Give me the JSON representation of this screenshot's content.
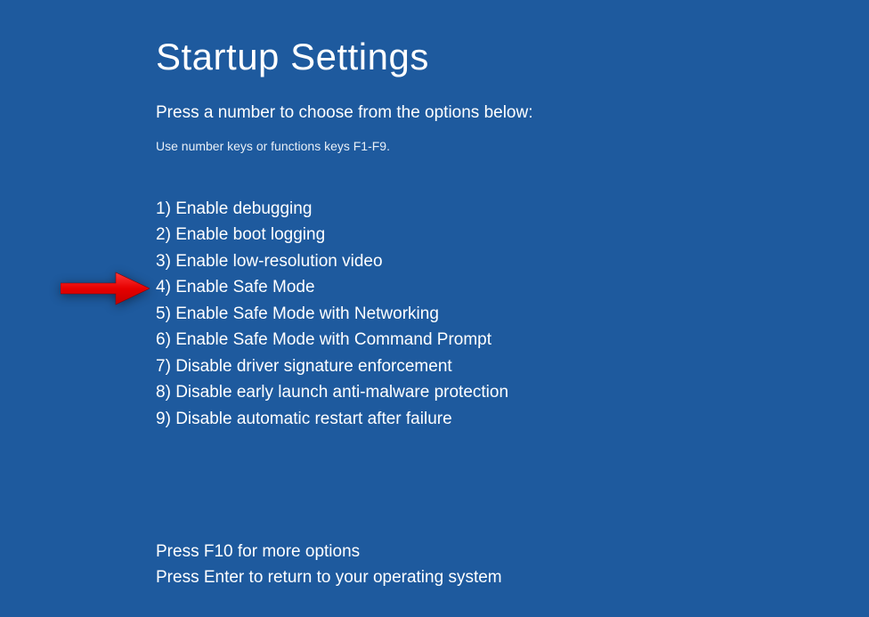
{
  "title": "Startup Settings",
  "instruction_primary": "Press a number to choose from the options below:",
  "instruction_secondary": "Use number keys or functions keys F1-F9.",
  "options": [
    {
      "num": "1",
      "label": "Enable debugging"
    },
    {
      "num": "2",
      "label": "Enable boot logging"
    },
    {
      "num": "3",
      "label": "Enable low-resolution video"
    },
    {
      "num": "4",
      "label": "Enable Safe Mode"
    },
    {
      "num": "5",
      "label": "Enable Safe Mode with Networking"
    },
    {
      "num": "6",
      "label": "Enable Safe Mode with Command Prompt"
    },
    {
      "num": "7",
      "label": "Disable driver signature enforcement"
    },
    {
      "num": "8",
      "label": "Disable early launch anti-malware protection"
    },
    {
      "num": "9",
      "label": "Disable automatic restart after failure"
    }
  ],
  "footer_line1": "Press F10 for more options",
  "footer_line2": "Press Enter to return to your operating system",
  "highlighted_option_index": 3,
  "colors": {
    "background": "#1e5a9e",
    "text": "#ffffff",
    "arrow": "#ff0000"
  }
}
